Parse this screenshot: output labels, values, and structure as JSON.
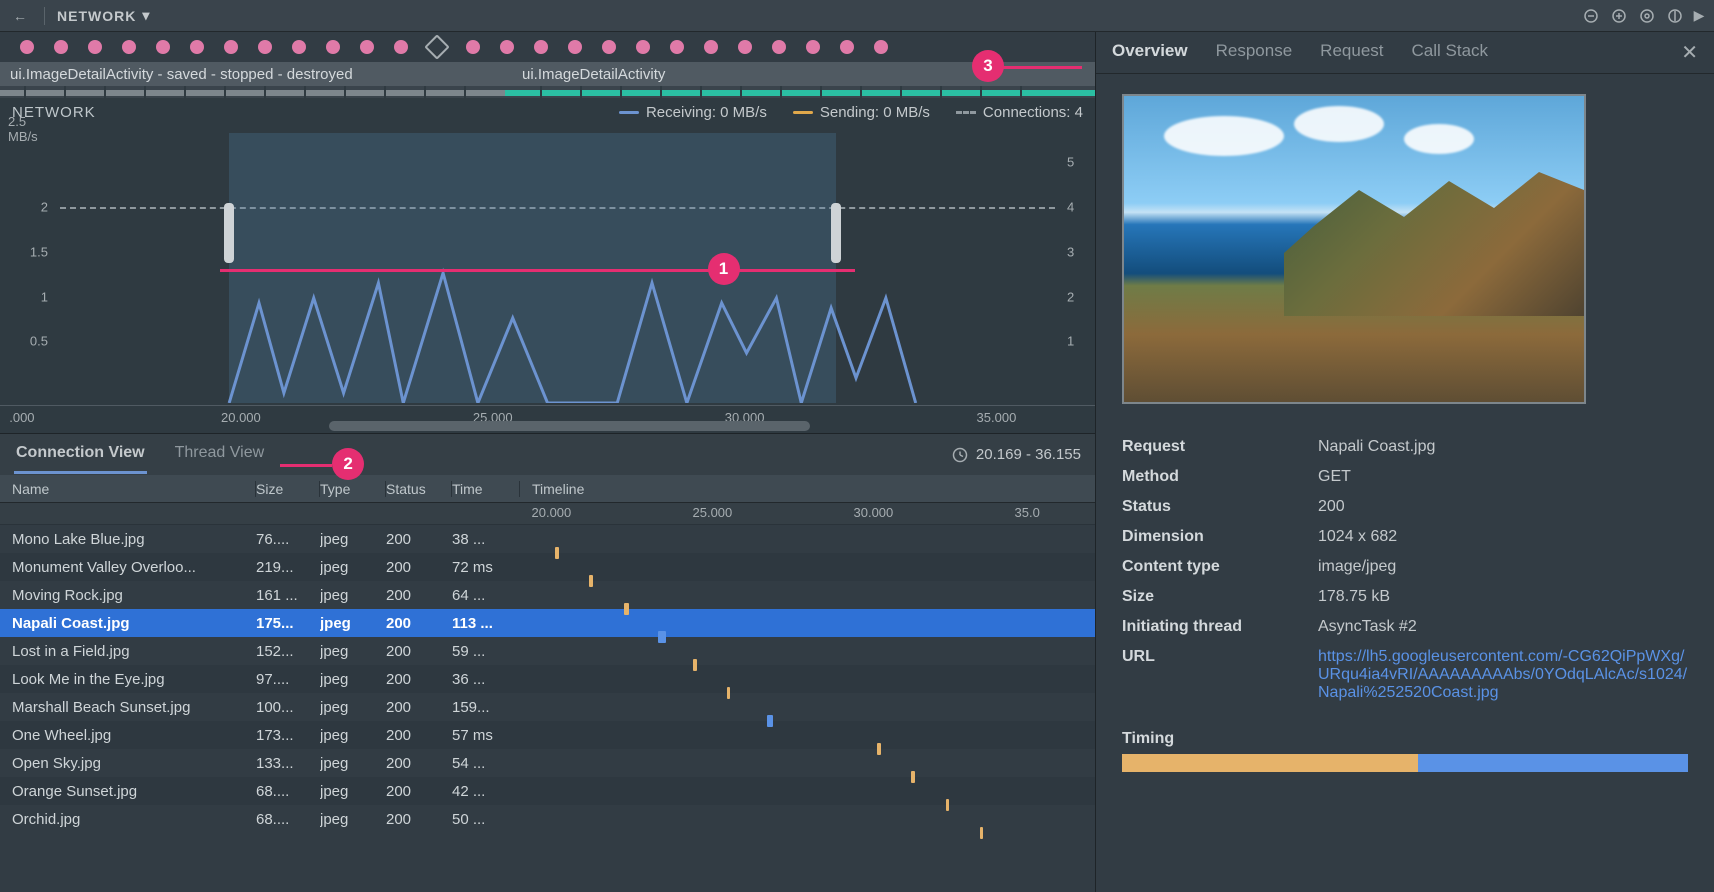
{
  "topbar": {
    "title": "NETWORK"
  },
  "activity": {
    "label1": "ui.ImageDetailActivity - saved - stopped - destroyed",
    "label2": "ui.ImageDetailActivity"
  },
  "chart": {
    "title": "NETWORK",
    "yunit": "2.5 MB/s",
    "legend_recv": "Receiving: 0 MB/s",
    "legend_send": "Sending: 0 MB/s",
    "legend_conn": "Connections: 4",
    "yleft": [
      "2",
      "1.5",
      "1",
      "0.5"
    ],
    "yright": [
      "5",
      "4",
      "3",
      "2",
      "1"
    ],
    "xticks": [
      ".000",
      "20.000",
      "25.000",
      "30.000",
      "35.000"
    ]
  },
  "chart_data": {
    "type": "line",
    "title": "NETWORK",
    "xlabel": "",
    "ylabel": "MB/s",
    "ylim_left": [
      0,
      2.5
    ],
    "ylim_right": [
      0,
      5
    ],
    "x_range": [
      15.0,
      37.0
    ],
    "selection": [
      20.169,
      36.155
    ],
    "series": [
      {
        "name": "Receiving",
        "unit": "MB/s",
        "color": "#6c93d0",
        "x": [
          20.2,
          20.6,
          21.2,
          21.8,
          22.4,
          23.2,
          23.8,
          24.6,
          25.4,
          26.0,
          26.8,
          27.8,
          28.6,
          29.4,
          30.2,
          30.8,
          31.6,
          32.4,
          33.2,
          33.8,
          34.6,
          35.2
        ],
        "y": [
          0.0,
          0.9,
          0.1,
          0.8,
          0.1,
          1.0,
          0.0,
          1.2,
          0.0,
          0.7,
          0.0,
          0.0,
          1.0,
          0.0,
          0.8,
          0.4,
          0.9,
          0.0,
          0.7,
          0.2,
          0.8,
          0.0
        ]
      },
      {
        "name": "Sending",
        "unit": "MB/s",
        "color": "#e0a84b",
        "x": [],
        "y": []
      },
      {
        "name": "Connections",
        "axis": "right",
        "style": "dashed",
        "color": "#8f989e",
        "x": [
          15.0,
          37.0
        ],
        "y": [
          4,
          4
        ]
      }
    ]
  },
  "midbar": {
    "tab_conn": "Connection View",
    "tab_thread": "Thread View",
    "range": "20.169 - 36.155"
  },
  "columns": {
    "name": "Name",
    "size": "Size",
    "type": "Type",
    "status": "Status",
    "time": "Time",
    "timeline": "Timeline"
  },
  "tl_ruler": [
    "20.000",
    "25.000",
    "30.000",
    "35.0"
  ],
  "rows": [
    {
      "name": "Mono Lake Blue.jpg",
      "size": "76....",
      "type": "jpeg",
      "status": "200",
      "time": "38 ...",
      "pos": 6,
      "w": 4,
      "sel": false
    },
    {
      "name": "Monument Valley Overloo...",
      "size": "219...",
      "type": "jpeg",
      "status": "200",
      "time": "72 ms",
      "pos": 12,
      "w": 4,
      "sel": false
    },
    {
      "name": "Moving Rock.jpg",
      "size": "161 ...",
      "type": "jpeg",
      "status": "200",
      "time": "64 ...",
      "pos": 18,
      "w": 5,
      "sel": false
    },
    {
      "name": "Napali Coast.jpg",
      "size": "175...",
      "type": "jpeg",
      "status": "200",
      "time": "113 ...",
      "pos": 24,
      "w": 8,
      "sel": true,
      "blue": true
    },
    {
      "name": "Lost in a Field.jpg",
      "size": "152...",
      "type": "jpeg",
      "status": "200",
      "time": "59 ...",
      "pos": 30,
      "w": 4,
      "sel": false
    },
    {
      "name": "Look Me in the Eye.jpg",
      "size": "97....",
      "type": "jpeg",
      "status": "200",
      "time": "36 ...",
      "pos": 36,
      "w": 3,
      "sel": false
    },
    {
      "name": "Marshall Beach Sunset.jpg",
      "size": "100...",
      "type": "jpeg",
      "status": "200",
      "time": "159...",
      "pos": 43,
      "w": 6,
      "sel": false,
      "blue": true
    },
    {
      "name": "One Wheel.jpg",
      "size": "173...",
      "type": "jpeg",
      "status": "200",
      "time": "57 ms",
      "pos": 62,
      "w": 4,
      "sel": false
    },
    {
      "name": "Open Sky.jpg",
      "size": "133...",
      "type": "jpeg",
      "status": "200",
      "time": "54 ...",
      "pos": 68,
      "w": 4,
      "sel": false
    },
    {
      "name": "Orange Sunset.jpg",
      "size": "68....",
      "type": "jpeg",
      "status": "200",
      "time": "42 ...",
      "pos": 74,
      "w": 3,
      "sel": false
    },
    {
      "name": "Orchid.jpg",
      "size": "68....",
      "type": "jpeg",
      "status": "200",
      "time": "50 ...",
      "pos": 80,
      "w": 3,
      "sel": false
    }
  ],
  "detail_tabs": {
    "overview": "Overview",
    "response": "Response",
    "request": "Request",
    "callstack": "Call Stack"
  },
  "detail": {
    "request_k": "Request",
    "request_v": "Napali Coast.jpg",
    "method_k": "Method",
    "method_v": "GET",
    "status_k": "Status",
    "status_v": "200",
    "dimension_k": "Dimension",
    "dimension_v": "1024 x 682",
    "ctype_k": "Content type",
    "ctype_v": "image/jpeg",
    "size_k": "Size",
    "size_v": "178.75 kB",
    "thread_k": "Initiating thread",
    "thread_v": "AsyncTask #2",
    "url_k": "URL",
    "url_v": "https://lh5.googleusercontent.com/-CG62QiPpWXg/URqu4ia4vRI/AAAAAAAAAbs/0YOdqLAlcAc/s1024/Napali%252520Coast.jpg",
    "timing_k": "Timing"
  },
  "callouts": {
    "c1": "1",
    "c2": "2",
    "c3": "3"
  }
}
